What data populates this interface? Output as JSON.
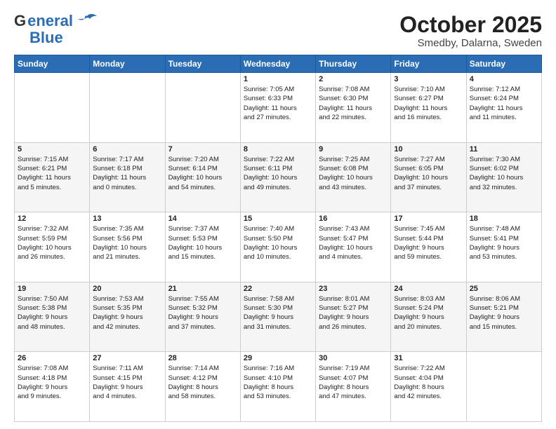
{
  "header": {
    "logo_line1": "General",
    "logo_line2": "Blue",
    "month": "October 2025",
    "location": "Smedby, Dalarna, Sweden"
  },
  "days_of_week": [
    "Sunday",
    "Monday",
    "Tuesday",
    "Wednesday",
    "Thursday",
    "Friday",
    "Saturday"
  ],
  "weeks": [
    [
      {
        "day": "",
        "info": ""
      },
      {
        "day": "",
        "info": ""
      },
      {
        "day": "",
        "info": ""
      },
      {
        "day": "1",
        "info": "Sunrise: 7:05 AM\nSunset: 6:33 PM\nDaylight: 11 hours\nand 27 minutes."
      },
      {
        "day": "2",
        "info": "Sunrise: 7:08 AM\nSunset: 6:30 PM\nDaylight: 11 hours\nand 22 minutes."
      },
      {
        "day": "3",
        "info": "Sunrise: 7:10 AM\nSunset: 6:27 PM\nDaylight: 11 hours\nand 16 minutes."
      },
      {
        "day": "4",
        "info": "Sunrise: 7:12 AM\nSunset: 6:24 PM\nDaylight: 11 hours\nand 11 minutes."
      }
    ],
    [
      {
        "day": "5",
        "info": "Sunrise: 7:15 AM\nSunset: 6:21 PM\nDaylight: 11 hours\nand 5 minutes."
      },
      {
        "day": "6",
        "info": "Sunrise: 7:17 AM\nSunset: 6:18 PM\nDaylight: 11 hours\nand 0 minutes."
      },
      {
        "day": "7",
        "info": "Sunrise: 7:20 AM\nSunset: 6:14 PM\nDaylight: 10 hours\nand 54 minutes."
      },
      {
        "day": "8",
        "info": "Sunrise: 7:22 AM\nSunset: 6:11 PM\nDaylight: 10 hours\nand 49 minutes."
      },
      {
        "day": "9",
        "info": "Sunrise: 7:25 AM\nSunset: 6:08 PM\nDaylight: 10 hours\nand 43 minutes."
      },
      {
        "day": "10",
        "info": "Sunrise: 7:27 AM\nSunset: 6:05 PM\nDaylight: 10 hours\nand 37 minutes."
      },
      {
        "day": "11",
        "info": "Sunrise: 7:30 AM\nSunset: 6:02 PM\nDaylight: 10 hours\nand 32 minutes."
      }
    ],
    [
      {
        "day": "12",
        "info": "Sunrise: 7:32 AM\nSunset: 5:59 PM\nDaylight: 10 hours\nand 26 minutes."
      },
      {
        "day": "13",
        "info": "Sunrise: 7:35 AM\nSunset: 5:56 PM\nDaylight: 10 hours\nand 21 minutes."
      },
      {
        "day": "14",
        "info": "Sunrise: 7:37 AM\nSunset: 5:53 PM\nDaylight: 10 hours\nand 15 minutes."
      },
      {
        "day": "15",
        "info": "Sunrise: 7:40 AM\nSunset: 5:50 PM\nDaylight: 10 hours\nand 10 minutes."
      },
      {
        "day": "16",
        "info": "Sunrise: 7:43 AM\nSunset: 5:47 PM\nDaylight: 10 hours\nand 4 minutes."
      },
      {
        "day": "17",
        "info": "Sunrise: 7:45 AM\nSunset: 5:44 PM\nDaylight: 9 hours\nand 59 minutes."
      },
      {
        "day": "18",
        "info": "Sunrise: 7:48 AM\nSunset: 5:41 PM\nDaylight: 9 hours\nand 53 minutes."
      }
    ],
    [
      {
        "day": "19",
        "info": "Sunrise: 7:50 AM\nSunset: 5:38 PM\nDaylight: 9 hours\nand 48 minutes."
      },
      {
        "day": "20",
        "info": "Sunrise: 7:53 AM\nSunset: 5:35 PM\nDaylight: 9 hours\nand 42 minutes."
      },
      {
        "day": "21",
        "info": "Sunrise: 7:55 AM\nSunset: 5:32 PM\nDaylight: 9 hours\nand 37 minutes."
      },
      {
        "day": "22",
        "info": "Sunrise: 7:58 AM\nSunset: 5:30 PM\nDaylight: 9 hours\nand 31 minutes."
      },
      {
        "day": "23",
        "info": "Sunrise: 8:01 AM\nSunset: 5:27 PM\nDaylight: 9 hours\nand 26 minutes."
      },
      {
        "day": "24",
        "info": "Sunrise: 8:03 AM\nSunset: 5:24 PM\nDaylight: 9 hours\nand 20 minutes."
      },
      {
        "day": "25",
        "info": "Sunrise: 8:06 AM\nSunset: 5:21 PM\nDaylight: 9 hours\nand 15 minutes."
      }
    ],
    [
      {
        "day": "26",
        "info": "Sunrise: 7:08 AM\nSunset: 4:18 PM\nDaylight: 9 hours\nand 9 minutes."
      },
      {
        "day": "27",
        "info": "Sunrise: 7:11 AM\nSunset: 4:15 PM\nDaylight: 9 hours\nand 4 minutes."
      },
      {
        "day": "28",
        "info": "Sunrise: 7:14 AM\nSunset: 4:12 PM\nDaylight: 8 hours\nand 58 minutes."
      },
      {
        "day": "29",
        "info": "Sunrise: 7:16 AM\nSunset: 4:10 PM\nDaylight: 8 hours\nand 53 minutes."
      },
      {
        "day": "30",
        "info": "Sunrise: 7:19 AM\nSunset: 4:07 PM\nDaylight: 8 hours\nand 47 minutes."
      },
      {
        "day": "31",
        "info": "Sunrise: 7:22 AM\nSunset: 4:04 PM\nDaylight: 8 hours\nand 42 minutes."
      },
      {
        "day": "",
        "info": ""
      }
    ]
  ]
}
